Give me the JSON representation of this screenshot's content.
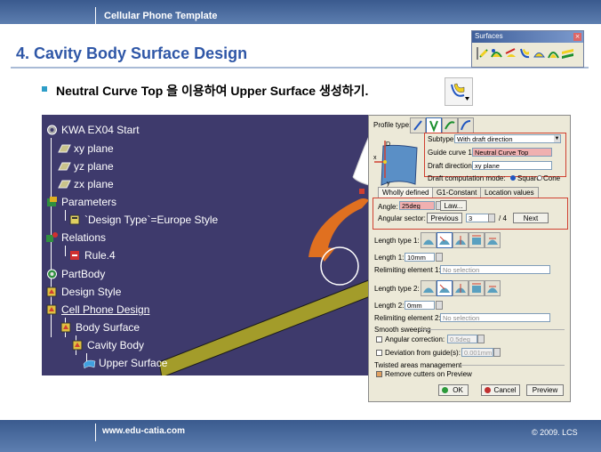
{
  "header": {
    "title": "Cellular Phone Template"
  },
  "slide": {
    "title": "4. Cavity Body Surface Design",
    "bullet": "Neutral Curve Top 을 이용하여 Upper Surface 생성하기."
  },
  "surfaces_toolbar": {
    "title": "Surfaces",
    "icons": [
      "extrude-icon",
      "revolve-icon",
      "sphere-icon",
      "sweep-icon",
      "fill-icon",
      "loft-icon",
      "blend-icon"
    ]
  },
  "tree": {
    "items": [
      {
        "label": "KWA EX04 Start",
        "icon": "part-gear-icon"
      },
      {
        "label": "xy plane",
        "icon": "plane-icon"
      },
      {
        "label": "yz plane",
        "icon": "plane-icon"
      },
      {
        "label": "zx plane",
        "icon": "plane-icon"
      },
      {
        "label": "Parameters",
        "icon": "parameters-icon"
      },
      {
        "label": "`Design Type`=Europe Style",
        "icon": "parameter-icon"
      },
      {
        "label": "Relations",
        "icon": "relations-icon"
      },
      {
        "label": "Rule.4",
        "icon": "rule-icon"
      },
      {
        "label": "PartBody",
        "icon": "partbody-icon"
      },
      {
        "label": "Design Style",
        "icon": "geometrical-set-icon"
      },
      {
        "label": "Cell Phone Design",
        "icon": "geometrical-set-icon"
      },
      {
        "label": "Body Surface",
        "icon": "geometrical-set-icon"
      },
      {
        "label": "Cavity Body",
        "icon": "geometrical-set-icon"
      },
      {
        "label": "Upper Surface",
        "icon": "surface-icon"
      }
    ]
  },
  "dialog": {
    "profile_type_label": "Profile type:",
    "subtype_label": "Subtype:",
    "subtype_value": "With draft direction",
    "guide_curve_label": "Guide curve 1:",
    "guide_curve_value": "Neutral Curve Top",
    "draft_direction_label": "Draft direction:",
    "draft_direction_value": "xy plane",
    "draft_mode_label": "Draft computation mode:",
    "draft_mode_square": "Square",
    "draft_mode_cone": "Cone",
    "tabs": [
      "Wholly defined",
      "G1-Constant",
      "Location values"
    ],
    "angle_label": "Angle:",
    "angle_value": "25deg",
    "law_button": "Law...",
    "angular_sector_label": "Angular sector:",
    "previous_button": "Previous",
    "sector_value": "3",
    "sector_total": "/ 4",
    "next_button": "Next",
    "length_type1_label": "Length type 1:",
    "length1_label": "Length 1:",
    "length1_value": "10mm",
    "relimiting1_label": "Relimiting element 1:",
    "relimiting1_value": "No selection",
    "length_type2_label": "Length type 2:",
    "length2_label": "Length 2:",
    "length2_value": "0mm",
    "relimiting2_label": "Relimiting element 2:",
    "relimiting2_value": "No selection",
    "smooth_sweeping_label": "Smooth sweeping",
    "angular_correction_label": "Angular correction:",
    "angular_correction_value": "0.5deg",
    "deviation_label": "Deviation from guide(s):",
    "deviation_value": "0.001mm",
    "twisted_label": "Twisted areas management",
    "remove_cutters_label": "Remove cutters on Preview",
    "ok_button": "OK",
    "cancel_button": "Cancel",
    "preview_button": "Preview",
    "axis_x": "x",
    "axis_y": "y",
    "axis_d": "D"
  },
  "footer": {
    "url": "www.edu-catia.com",
    "copyright": "© 2009. LCS"
  },
  "colors": {
    "header_blue": "#3a5a8e",
    "title_blue": "#2f57a7",
    "viewport_bg": "#3e3a6c",
    "surface_olive": "#a39c2a",
    "dialog_bg": "#ece9d8",
    "highlight_red": "#d04030",
    "arrow_orange": "#e07020"
  }
}
